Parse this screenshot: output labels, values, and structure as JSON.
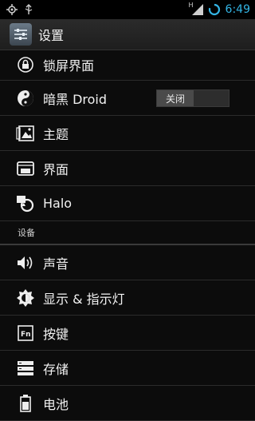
{
  "statusbar": {
    "time": "6:49",
    "network_label": "H",
    "icons": [
      "gps-icon",
      "usb-icon",
      "signal-icon",
      "battery-ring-icon"
    ]
  },
  "actionbar": {
    "title": "设置",
    "icon": "settings-app-icon"
  },
  "items": [
    {
      "label": "锁屏界面",
      "icon": "lock-icon"
    },
    {
      "label": "暗黑 Droid",
      "icon": "yin-yang-icon",
      "toggle": "关闭"
    },
    {
      "label": "主题",
      "icon": "theme-icon"
    },
    {
      "label": "界面",
      "icon": "interface-icon"
    },
    {
      "label": "Halo",
      "icon": "halo-icon"
    }
  ],
  "section": {
    "title": "设备"
  },
  "device_items": [
    {
      "label": "声音",
      "icon": "speaker-icon"
    },
    {
      "label": "显示 & 指示灯",
      "icon": "brightness-icon"
    },
    {
      "label": "按键",
      "icon": "fn-key-icon"
    },
    {
      "label": "存储",
      "icon": "storage-icon"
    },
    {
      "label": "电池",
      "icon": "battery-icon"
    }
  ],
  "colors": {
    "accent": "#33b5e5",
    "background": "#0c0c0c"
  }
}
